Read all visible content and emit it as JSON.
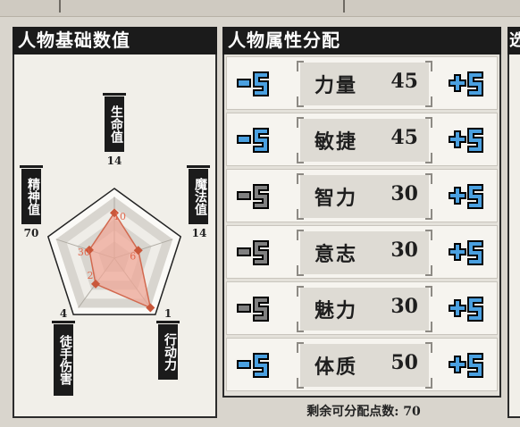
{
  "basic_stats": {
    "title": "人物基础数值",
    "stats": [
      {
        "name": "生命值",
        "value": 14,
        "shown_level": 10
      },
      {
        "name": "魔法值",
        "value": 14,
        "shown_level": 6
      },
      {
        "name": "行动力",
        "value": 1,
        "shown_level": 1
      },
      {
        "name": "徒手伤害",
        "value": 4,
        "shown_level": 2
      },
      {
        "name": "精神值",
        "value": 70,
        "shown_level": 30
      }
    ],
    "colors": {
      "fill": "#f0a695",
      "stroke": "#d2694f",
      "point": "#c9573a"
    }
  },
  "allocation": {
    "title": "人物属性分配",
    "attributes": [
      {
        "name": "力量",
        "value": "45",
        "minus_enabled": true
      },
      {
        "name": "敏捷",
        "value": "45",
        "minus_enabled": true
      },
      {
        "name": "智力",
        "value": "30",
        "minus_enabled": false
      },
      {
        "name": "意志",
        "value": "30",
        "minus_enabled": false
      },
      {
        "name": "魅力",
        "value": "30",
        "minus_enabled": false
      },
      {
        "name": "体质",
        "value": "50",
        "minus_enabled": true
      }
    ],
    "remaining_label": "剩余可分配点数: 70",
    "colors": {
      "enabled": "#4aa0e0",
      "disabled": "#808080"
    }
  },
  "third_panel": {
    "title": "选"
  }
}
